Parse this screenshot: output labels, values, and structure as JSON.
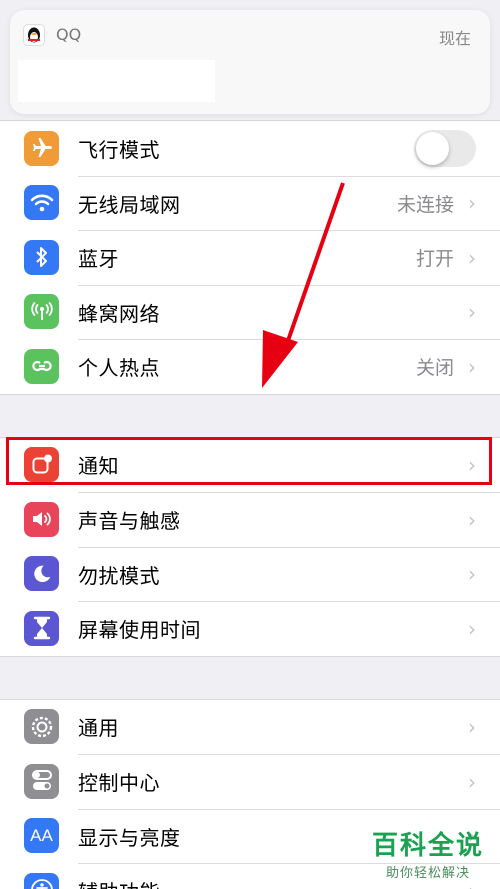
{
  "banner": {
    "app_name": "QQ",
    "time": "现在"
  },
  "group1": [
    {
      "label": "飞行模式",
      "value": "",
      "icon": "airplane-icon",
      "color": "#f19a38",
      "control": "toggle"
    },
    {
      "label": "无线局域网",
      "value": "未连接",
      "icon": "wifi-icon",
      "color": "#3478f6",
      "control": "chevron"
    },
    {
      "label": "蓝牙",
      "value": "打开",
      "icon": "bluetooth-icon",
      "color": "#3478f6",
      "control": "chevron"
    },
    {
      "label": "蜂窝网络",
      "value": "",
      "icon": "cellular-icon",
      "color": "#5ac35e",
      "control": "chevron"
    },
    {
      "label": "个人热点",
      "value": "关闭",
      "icon": "hotspot-icon",
      "color": "#5ac35e",
      "control": "chevron"
    }
  ],
  "group2": [
    {
      "label": "通知",
      "icon": "notifications-icon",
      "color": "#ea4335"
    },
    {
      "label": "声音与触感",
      "icon": "speaker-icon",
      "color": "#e8445a"
    },
    {
      "label": "勿扰模式",
      "icon": "moon-icon",
      "color": "#5b57d3"
    },
    {
      "label": "屏幕使用时间",
      "icon": "hourglass-icon",
      "color": "#5b57d3"
    }
  ],
  "group3": [
    {
      "label": "通用",
      "icon": "gear-icon",
      "color": "#8e8e93"
    },
    {
      "label": "控制中心",
      "icon": "switches-icon",
      "color": "#8e8e93"
    },
    {
      "label": "显示与亮度",
      "icon": "text-size-icon",
      "color": "#3478f6"
    },
    {
      "label": "辅助功能",
      "icon": "accessibility-icon",
      "color": "#3478f6"
    }
  ],
  "chevron": "›",
  "watermark": {
    "title": "百科全说",
    "subtitle": "助你轻松解决"
  }
}
